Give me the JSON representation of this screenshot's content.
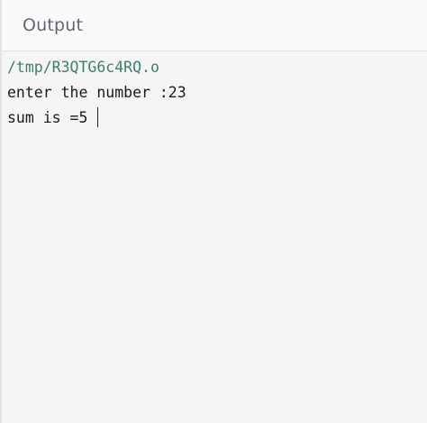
{
  "header": {
    "title": "Output"
  },
  "output": {
    "path": "/tmp/R3QTG6c4RQ.o",
    "lines": [
      "enter the number :23",
      "sum is =5 "
    ]
  },
  "colors": {
    "path_text": "#3d7f6f",
    "header_text": "#5f6775",
    "background": "#f5f5f5"
  }
}
